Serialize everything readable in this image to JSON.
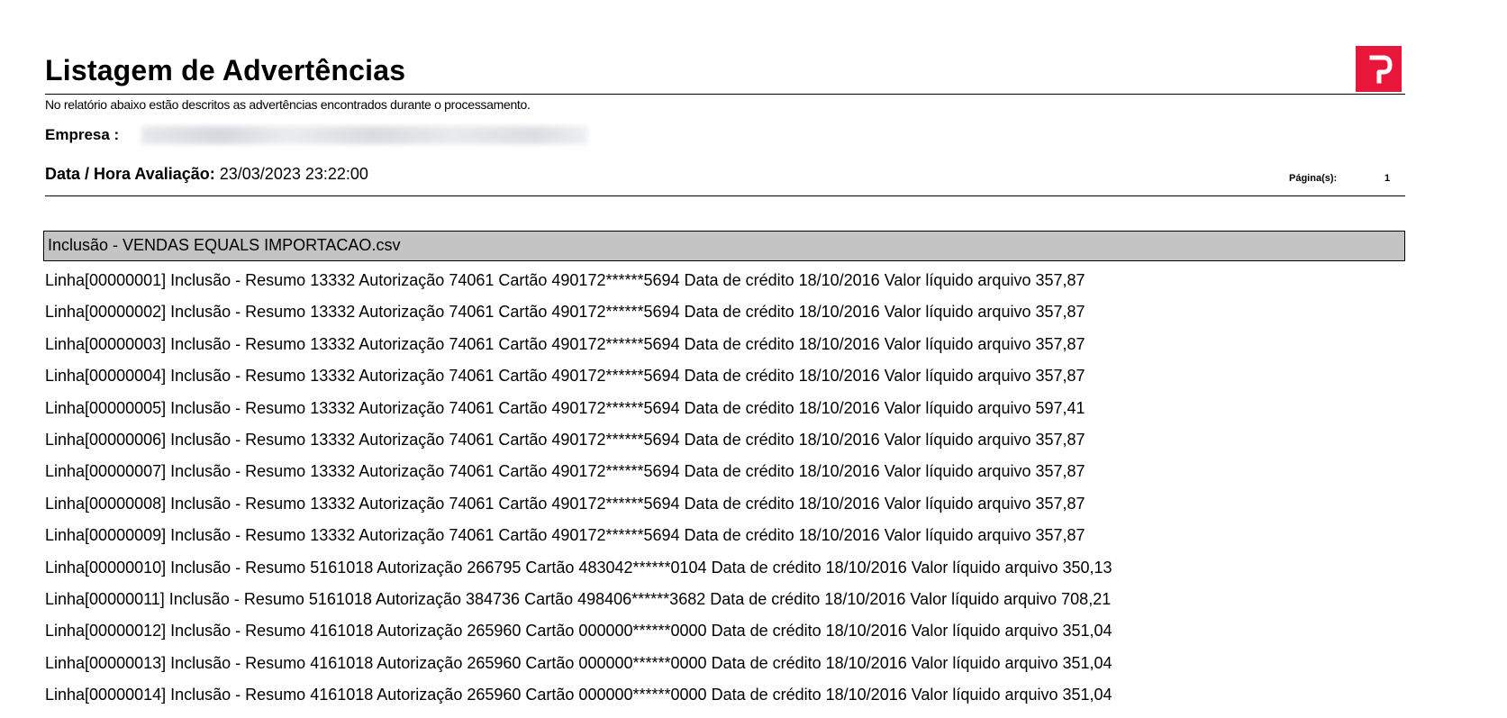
{
  "report": {
    "title": "Listagem de Advertências",
    "subtitle": "No relatório abaixo estão descritos as advertências encontrados durante o processamento.",
    "empresa_label": "Empresa :",
    "data_hora_label": "Data / Hora Avaliação:",
    "data_hora_value": "23/03/2023 23:22:00",
    "pagina_label": "Página(s):",
    "pagina_value": "1",
    "logo_color": "#e8173a"
  },
  "section": {
    "title": "Inclusão - VENDAS EQUALS IMPORTACAO.csv"
  },
  "lines": [
    "Linha[00000001] Inclusão - Resumo 13332 Autorização 74061 Cartão 490172******5694 Data de crédito 18/10/2016 Valor líquido arquivo 357,87",
    "Linha[00000002] Inclusão - Resumo 13332 Autorização 74061 Cartão 490172******5694 Data de crédito 18/10/2016 Valor líquido arquivo 357,87",
    "Linha[00000003] Inclusão - Resumo 13332 Autorização 74061 Cartão 490172******5694 Data de crédito 18/10/2016 Valor líquido arquivo 357,87",
    "Linha[00000004] Inclusão - Resumo 13332 Autorização 74061 Cartão 490172******5694 Data de crédito 18/10/2016 Valor líquido arquivo 357,87",
    "Linha[00000005] Inclusão - Resumo 13332 Autorização 74061 Cartão 490172******5694 Data de crédito 18/10/2016 Valor líquido arquivo 597,41",
    "Linha[00000006] Inclusão - Resumo 13332 Autorização 74061 Cartão 490172******5694 Data de crédito 18/10/2016 Valor líquido arquivo 357,87",
    "Linha[00000007] Inclusão - Resumo 13332 Autorização 74061 Cartão 490172******5694 Data de crédito 18/10/2016 Valor líquido arquivo 357,87",
    "Linha[00000008] Inclusão - Resumo 13332 Autorização 74061 Cartão 490172******5694 Data de crédito 18/10/2016 Valor líquido arquivo 357,87",
    "Linha[00000009] Inclusão - Resumo 13332 Autorização 74061 Cartão 490172******5694 Data de crédito 18/10/2016 Valor líquido arquivo 357,87",
    "Linha[00000010] Inclusão - Resumo 5161018 Autorização 266795 Cartão 483042******0104 Data de crédito 18/10/2016 Valor líquido arquivo 350,13",
    "Linha[00000011] Inclusão - Resumo 5161018 Autorização 384736 Cartão 498406******3682 Data de crédito 18/10/2016 Valor líquido arquivo 708,21",
    "Linha[00000012] Inclusão - Resumo 4161018 Autorização 265960 Cartão 000000******0000 Data de crédito 18/10/2016 Valor líquido arquivo 351,04",
    "Linha[00000013] Inclusão - Resumo 4161018 Autorização 265960 Cartão 000000******0000 Data de crédito 18/10/2016 Valor líquido arquivo 351,04",
    "Linha[00000014] Inclusão - Resumo 4161018 Autorização 265960 Cartão 000000******0000 Data de crédito 18/10/2016 Valor líquido arquivo 351,04"
  ]
}
